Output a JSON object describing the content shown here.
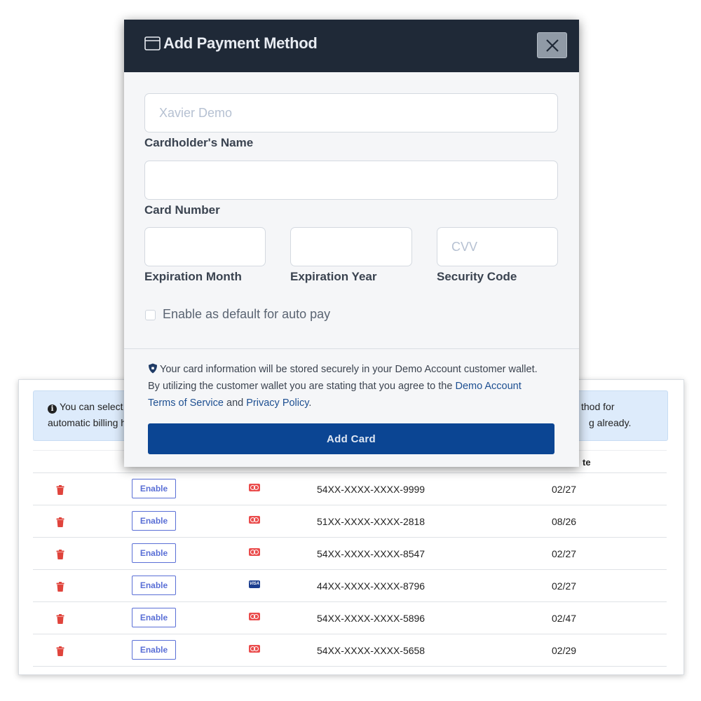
{
  "background": {
    "info": {
      "left_line1": "You can select",
      "left_line2": "automatic billing h",
      "right_line1": "thod for",
      "right_line2": "g already."
    },
    "table": {
      "header_visible": "te",
      "rows": [
        {
          "action": "Enable",
          "card_type": "mastercard",
          "number": "54XX-XXXX-XXXX-9999",
          "expires": "02/27"
        },
        {
          "action": "Enable",
          "card_type": "mastercard",
          "number": "51XX-XXXX-XXXX-2818",
          "expires": "08/26"
        },
        {
          "action": "Enable",
          "card_type": "mastercard",
          "number": "54XX-XXXX-XXXX-8547",
          "expires": "02/27"
        },
        {
          "action": "Enable",
          "card_type": "visa",
          "visa_text": "VISA",
          "number": "44XX-XXXX-XXXX-8796",
          "expires": "02/27"
        },
        {
          "action": "Enable",
          "card_type": "mastercard",
          "number": "54XX-XXXX-XXXX-5896",
          "expires": "02/47"
        },
        {
          "action": "Enable",
          "card_type": "mastercard",
          "number": "54XX-XXXX-XXXX-5658",
          "expires": "02/29"
        }
      ]
    }
  },
  "modal": {
    "title": "Add Payment Method",
    "fields": {
      "cardholder_name": {
        "label": "Cardholder's Name",
        "placeholder": "Xavier Demo",
        "value": ""
      },
      "card_number": {
        "label": "Card Number",
        "placeholder": "",
        "value": ""
      },
      "exp_month": {
        "label": "Expiration Month",
        "placeholder": "",
        "value": ""
      },
      "exp_year": {
        "label": "Expiration Year",
        "placeholder": "",
        "value": ""
      },
      "security_code": {
        "label": "Security Code",
        "placeholder": "CVV",
        "value": ""
      }
    },
    "autopay_label": "Enable as default for auto pay",
    "footer": {
      "line1": "Your card information will be stored securely in your Demo Account customer wallet.",
      "line2_text": "By utilizing the customer wallet you are stating that you agree to the",
      "demo_account_link": "Demo Account",
      "tos_link": "Terms of Service",
      "and_text": "and",
      "privacy_link": "Privacy Policy",
      "period": "."
    },
    "submit_label": "Add Card"
  },
  "colors": {
    "header_bg": "#1f2937",
    "primary_button": "#0b4593",
    "link": "#1d4f91",
    "trash": "#e0443c",
    "enable_outline": "#5a6fd6"
  }
}
